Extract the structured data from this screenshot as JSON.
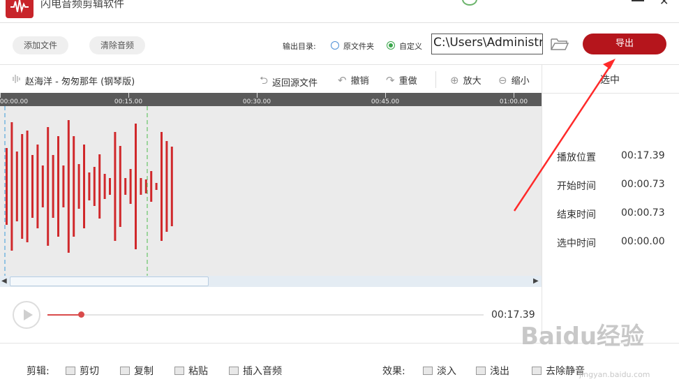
{
  "app": {
    "title": "闪电音频剪辑软件",
    "user": "",
    "close": "✕"
  },
  "toolbar": {
    "add_file": "添加文件",
    "clear_audio": "清除音频",
    "output_dir_label": "输出目录:",
    "option_source_folder": "原文件夹",
    "option_custom": "自定义",
    "output_path": "C:\\Users\\Administrator",
    "export": "导出"
  },
  "track": {
    "title": "赵海洋 - 匆匆那年 (钢琴版)",
    "tools": {
      "revert": "返回源文件",
      "undo": "撤销",
      "redo": "重做",
      "zoom_in": "放大",
      "zoom_out": "缩小"
    }
  },
  "timeline": {
    "ticks": [
      "00:00.00",
      "00:15.00",
      "00:30.00",
      "00:45.00",
      "01:00.00"
    ]
  },
  "waveform": {
    "color": "#d0282b",
    "amplitudes": [
      0.55,
      0.92,
      0.5,
      0.75,
      0.8,
      0.45,
      0.6,
      0.3,
      0.85,
      0.45,
      0.72,
      0.3,
      0.95,
      0.72,
      0.32,
      0.6,
      0.2,
      0.28,
      0.46,
      0.18,
      0.12,
      0.78,
      0.58,
      0.12,
      0.25,
      0.9,
      0.12,
      0.1,
      0.22,
      0.05,
      0.78,
      0.65,
      0.57
    ]
  },
  "selection": {
    "title": "选中",
    "play_position_label": "播放位置",
    "play_position": "00:17.39",
    "start_label": "开始时间",
    "start": "00:00.73",
    "end_label": "结束时间",
    "end": "00:00.73",
    "duration_label": "选中时间",
    "duration": "00:00.00"
  },
  "player": {
    "time": "00:17.39",
    "progress": 0.077
  },
  "edit_bar": {
    "edit_label": "剪辑:",
    "cut": "剪切",
    "copy": "复制",
    "paste": "粘贴",
    "insert_audio": "插入音频",
    "effect_label": "效果:",
    "fade_in": "淡入",
    "fade_out": "浅出",
    "remove_silence": "去除静音"
  },
  "watermark": {
    "text": "Baidu经验",
    "sub": "jingyan.baidu.com"
  },
  "colors": {
    "accent": "#b5151c",
    "annotation": "#ff2a2a"
  }
}
